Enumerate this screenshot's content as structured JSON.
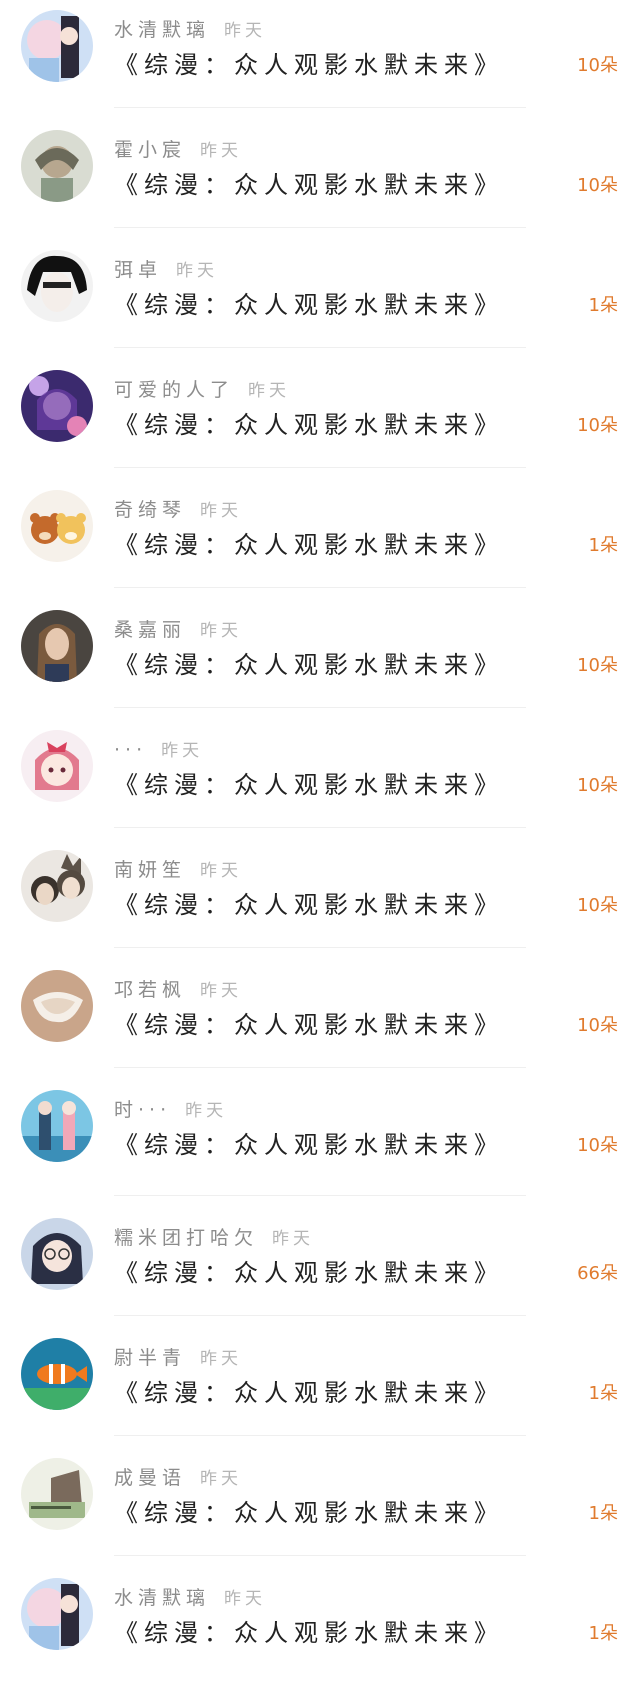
{
  "feed": [
    {
      "user": "水清默璃",
      "time": "昨天",
      "book": "《综漫：众人观影水默未来》",
      "count": "10朵",
      "avatar": "avatar-anime-girl-blue"
    },
    {
      "user": "霍小宸",
      "time": "昨天",
      "book": "《综漫：众人观影水默未来》",
      "count": "10朵",
      "avatar": "avatar-sketch-girl"
    },
    {
      "user": "弭卓",
      "time": "昨天",
      "book": "《综漫：众人观影水默未来》",
      "count": "1朵",
      "avatar": "avatar-dark-hair-boy"
    },
    {
      "user": "可爱的人了",
      "time": "昨天",
      "book": "《综漫：众人观影水默未来》",
      "count": "10朵",
      "avatar": "avatar-purple-girl"
    },
    {
      "user": "奇绮琴",
      "time": "昨天",
      "book": "《综漫：众人观影水默未来》",
      "count": "1朵",
      "avatar": "avatar-rilakkuma-bears"
    },
    {
      "user": "桑嘉丽",
      "time": "昨天",
      "book": "《综漫：众人观影水默未来》",
      "count": "10朵",
      "avatar": "avatar-woman-photo"
    },
    {
      "user": "···",
      "time": "昨天",
      "book": "《综漫：众人观影水默未来》",
      "count": "10朵",
      "avatar": "avatar-chibi-girl-pink"
    },
    {
      "user": "南妍笙",
      "time": "昨天",
      "book": "《综漫：众人观影水默未来》",
      "count": "10朵",
      "avatar": "avatar-couple-cat-ears"
    },
    {
      "user": "邛若枫",
      "time": "昨天",
      "book": "《综漫：众人观影水默未来》",
      "count": "10朵",
      "avatar": "avatar-shell"
    },
    {
      "user": "时···",
      "time": "昨天",
      "book": "《综漫：众人观影水默未来》",
      "count": "10朵",
      "avatar": "avatar-couple-sea"
    },
    {
      "user": "糯米团打哈欠",
      "time": "昨天",
      "book": "《综漫：众人观影水默未来》",
      "count": "66朵",
      "avatar": "avatar-glasses-girl"
    },
    {
      "user": "尉半青",
      "time": "昨天",
      "book": "《综漫：众人观影水默未来》",
      "count": "1朵",
      "avatar": "avatar-clownfish"
    },
    {
      "user": "成曼语",
      "time": "昨天",
      "book": "《综漫：众人观影水默未来》",
      "count": "1朵",
      "avatar": "avatar-house-sketch"
    },
    {
      "user": "水清默璃",
      "time": "昨天",
      "book": "《综漫：众人观影水默未来》",
      "count": "1朵",
      "avatar": "avatar-anime-girl-blue"
    }
  ],
  "colors": {
    "count": "#e07b2e",
    "user": "#8c8c8c",
    "time": "#b5b5b5",
    "book": "#222222"
  }
}
